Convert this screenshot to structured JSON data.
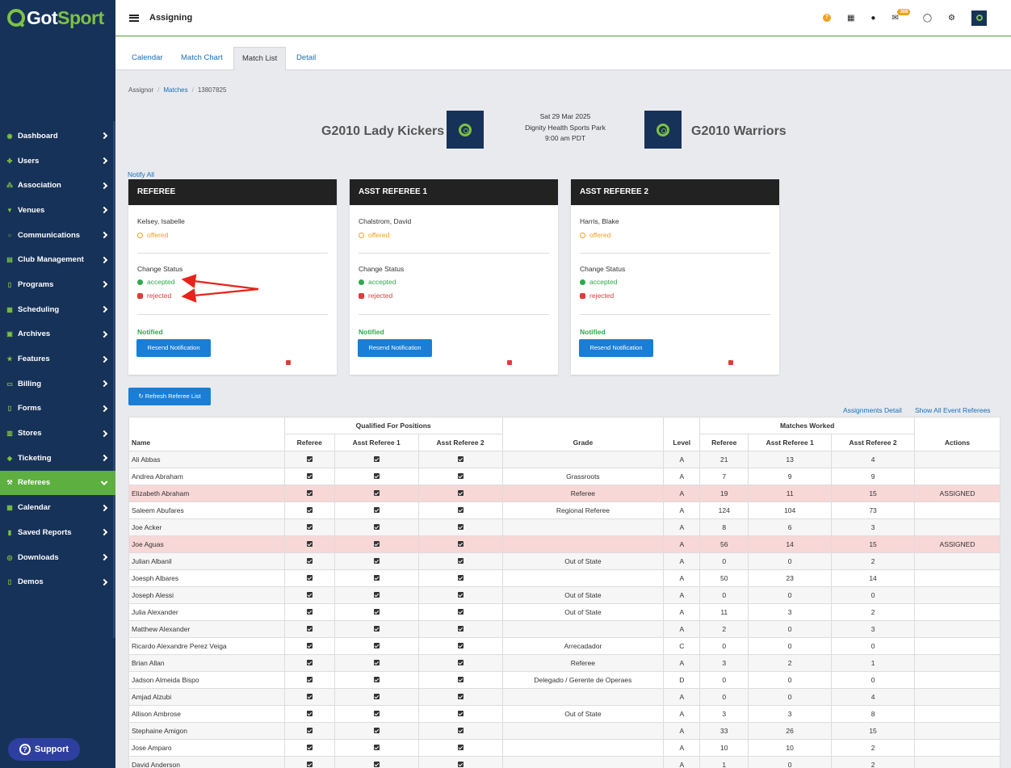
{
  "brand": {
    "got": "Got",
    "sport": "Sport"
  },
  "sidebar": {
    "items": [
      {
        "label": "Dashboard",
        "icon": "dashboard-icon",
        "glyph": "◉"
      },
      {
        "label": "Users",
        "icon": "users-icon",
        "glyph": "✤"
      },
      {
        "label": "Association",
        "icon": "sitemap-icon",
        "glyph": "⁂"
      },
      {
        "label": "Venues",
        "icon": "map-marker-icon",
        "glyph": "▼"
      },
      {
        "label": "Communications",
        "icon": "chat-icon",
        "glyph": "○"
      },
      {
        "label": "Club Management",
        "icon": "id-card-icon",
        "glyph": "▤"
      },
      {
        "label": "Programs",
        "icon": "file-icon",
        "glyph": "▯"
      },
      {
        "label": "Scheduling",
        "icon": "calendar-icon",
        "glyph": "▦"
      },
      {
        "label": "Archives",
        "icon": "archive-icon",
        "glyph": "▣"
      },
      {
        "label": "Features",
        "icon": "star-icon",
        "glyph": "★"
      },
      {
        "label": "Billing",
        "icon": "credit-card-icon",
        "glyph": "▭"
      },
      {
        "label": "Forms",
        "icon": "file-icon",
        "glyph": "▯"
      },
      {
        "label": "Stores",
        "icon": "store-icon",
        "glyph": "▥"
      },
      {
        "label": "Ticketing",
        "icon": "ticket-icon",
        "glyph": "◆"
      },
      {
        "label": "Referees",
        "icon": "gavel-icon",
        "glyph": "⚒"
      },
      {
        "label": "Calendar",
        "icon": "calendar-icon",
        "glyph": "▦"
      },
      {
        "label": "Saved Reports",
        "icon": "bookmark-icon",
        "glyph": "▮"
      },
      {
        "label": "Downloads",
        "icon": "download-icon",
        "glyph": "◎"
      },
      {
        "label": "Demos",
        "icon": "file-icon",
        "glyph": "▯"
      }
    ],
    "active_index": 14,
    "support_label": "Support"
  },
  "topbar": {
    "title": "Assigning",
    "mail_count": "308",
    "help_glyph": "?"
  },
  "tabs": [
    "Calendar",
    "Match Chart",
    "Match List",
    "Detail"
  ],
  "active_tab": 2,
  "breadcrumb": {
    "root": "Assignor",
    "matches": "Matches",
    "id": "13807825"
  },
  "match": {
    "home": "G2010 Lady Kickers",
    "away": "G2010 Warriors",
    "date": "Sat 29 Mar 2025",
    "venue": "Dignity Health Sports Park",
    "time": "9:00 am PDT"
  },
  "notify_all": "Notify All",
  "cards": [
    {
      "title": "REFEREE",
      "name": "Kelsey, Isabelle"
    },
    {
      "title": "ASST REFEREE 1",
      "name": "Chalstrom, David"
    },
    {
      "title": "ASST REFEREE 2",
      "name": "Harris, Blake"
    }
  ],
  "card_labels": {
    "offered": "offered",
    "change_status": "Change Status",
    "accepted": "accepted",
    "rejected": "rejected",
    "notified": "Notified",
    "resend": "Resend Notification"
  },
  "refresh_label": "Refresh Referee List",
  "links": {
    "assignments_detail": "Assignments Detail",
    "show_all": "Show All Event Referees"
  },
  "table": {
    "group_headers": {
      "qualified": "Qualified For Positions",
      "matches_worked": "Matches Worked"
    },
    "headers": {
      "name": "Name",
      "referee": "Referee",
      "ar1": "Asst Referee 1",
      "ar2": "Asst Referee 2",
      "grade": "Grade",
      "level": "Level",
      "actions": "Actions"
    },
    "rows": [
      {
        "name": "Ali Abbas",
        "grade": "",
        "level": "A",
        "ref": "21",
        "ar1": "13",
        "ar2": "4",
        "action": ""
      },
      {
        "name": "Andrea Abraham",
        "grade": "Grassroots",
        "level": "A",
        "ref": "7",
        "ar1": "9",
        "ar2": "9",
        "action": ""
      },
      {
        "name": "Elizabeth Abraham",
        "grade": "Referee",
        "level": "A",
        "ref": "19",
        "ar1": "11",
        "ar2": "15",
        "action": "ASSIGNED"
      },
      {
        "name": "Saleem Abufares",
        "grade": "Regional Referee",
        "level": "A",
        "ref": "124",
        "ar1": "104",
        "ar2": "73",
        "action": ""
      },
      {
        "name": "Joe Acker",
        "grade": "",
        "level": "A",
        "ref": "8",
        "ar1": "6",
        "ar2": "3",
        "action": ""
      },
      {
        "name": "Joe Aguas",
        "grade": "",
        "level": "A",
        "ref": "56",
        "ar1": "14",
        "ar2": "15",
        "action": "ASSIGNED"
      },
      {
        "name": "Julian Albanil",
        "grade": "Out of State",
        "level": "A",
        "ref": "0",
        "ar1": "0",
        "ar2": "2",
        "action": ""
      },
      {
        "name": "Joesph Albares",
        "grade": "",
        "level": "A",
        "ref": "50",
        "ar1": "23",
        "ar2": "14",
        "action": ""
      },
      {
        "name": "Joseph Alessi",
        "grade": "Out of State",
        "level": "A",
        "ref": "0",
        "ar1": "0",
        "ar2": "0",
        "action": ""
      },
      {
        "name": "Julia Alexander",
        "grade": "Out of State",
        "level": "A",
        "ref": "11",
        "ar1": "3",
        "ar2": "2",
        "action": ""
      },
      {
        "name": "Matthew Alexander",
        "grade": "",
        "level": "A",
        "ref": "2",
        "ar1": "0",
        "ar2": "3",
        "action": ""
      },
      {
        "name": "Ricardo Alexandre Perez Veiga",
        "grade": "Arrecadador",
        "level": "C",
        "ref": "0",
        "ar1": "0",
        "ar2": "0",
        "action": ""
      },
      {
        "name": "Brian Allan",
        "grade": "Referee",
        "level": "A",
        "ref": "3",
        "ar1": "2",
        "ar2": "1",
        "action": ""
      },
      {
        "name": "Jadson Almeida Bispo",
        "grade": "Delegado / Gerente de Operaes",
        "level": "D",
        "ref": "0",
        "ar1": "0",
        "ar2": "0",
        "action": ""
      },
      {
        "name": "Amjad Alzubi",
        "grade": "",
        "level": "A",
        "ref": "0",
        "ar1": "0",
        "ar2": "4",
        "action": ""
      },
      {
        "name": "Allison Ambrose",
        "grade": "Out of State",
        "level": "A",
        "ref": "3",
        "ar1": "3",
        "ar2": "8",
        "action": ""
      },
      {
        "name": "Stephaine Amigon",
        "grade": "",
        "level": "A",
        "ref": "33",
        "ar1": "26",
        "ar2": "15",
        "action": ""
      },
      {
        "name": "Jose Amparo",
        "grade": "",
        "level": "A",
        "ref": "10",
        "ar1": "10",
        "ar2": "2",
        "action": ""
      },
      {
        "name": "David Anderson",
        "grade": "",
        "level": "A",
        "ref": "1",
        "ar1": "0",
        "ar2": "2",
        "action": ""
      }
    ]
  },
  "colors": {
    "sidebar": "#173258",
    "accent_green": "#5daf3f",
    "link": "#1a6fb5",
    "offered": "#f0a020",
    "accepted": "#2ea84a",
    "rejected": "#e03c3c",
    "assigned_row": "#f8d7d7",
    "annotation_arrow": "#e8231a"
  }
}
